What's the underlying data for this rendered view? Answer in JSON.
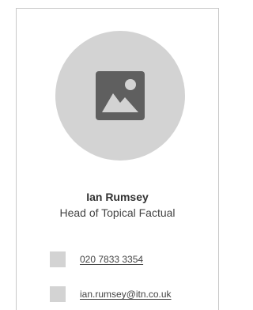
{
  "contact_card": {
    "avatar_icon": "image-placeholder-icon",
    "name": "Ian Rumsey",
    "job_title": "Head of Topical Factual",
    "phone": {
      "icon": "phone-icon",
      "text": "020 7833 3354"
    },
    "email": {
      "icon": "email-icon",
      "text": "ian.rumsey@itn.co.uk"
    }
  },
  "colors": {
    "border": "#c9c9c9",
    "placeholder": "#d3d3d3",
    "icon_dark": "#5f5f5f",
    "text": "#444444"
  }
}
